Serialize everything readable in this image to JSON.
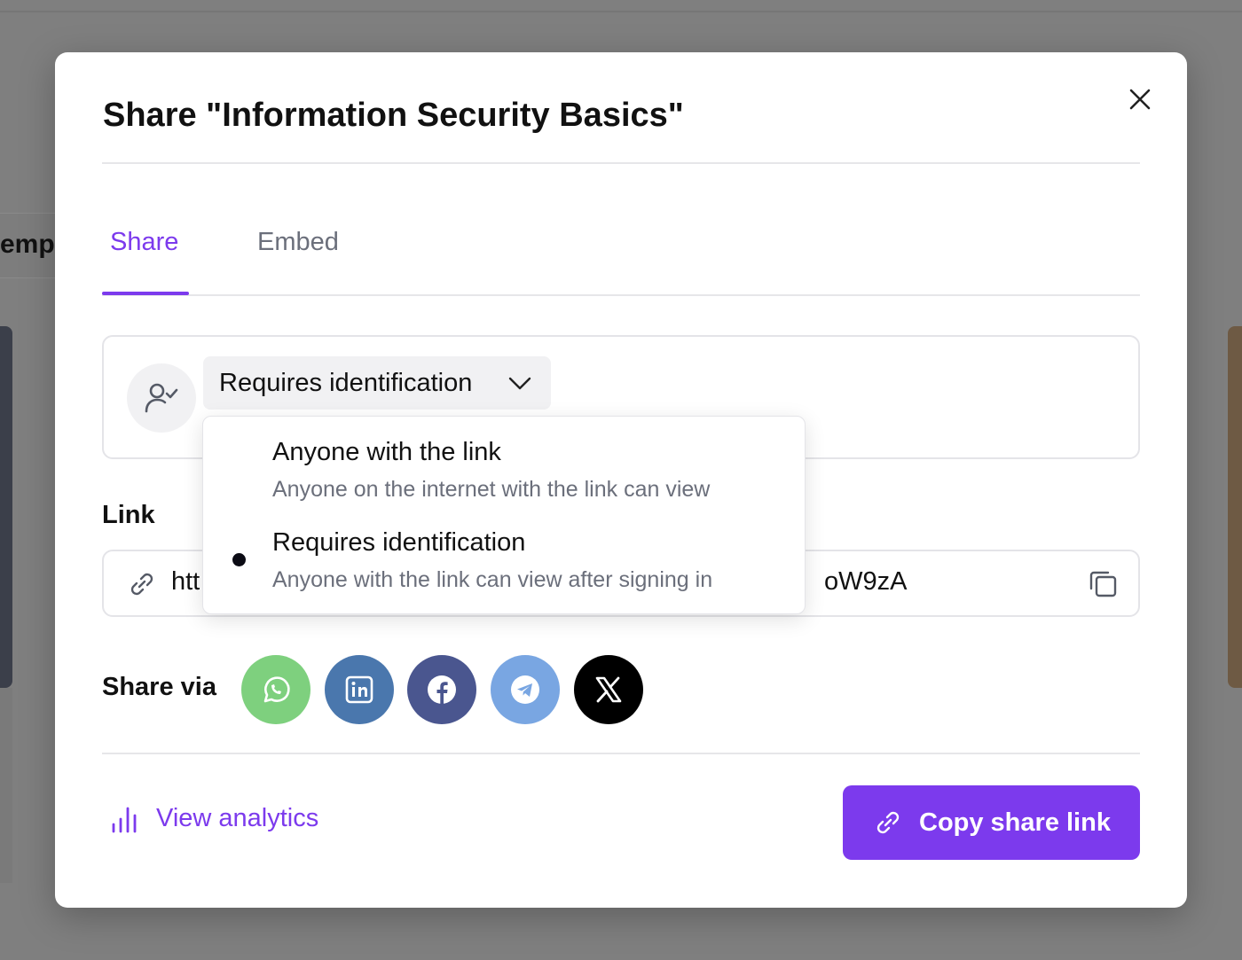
{
  "background": {
    "tab_fragment": "empt"
  },
  "modal": {
    "title": "Share \"Information Security Basics\"",
    "tabs": [
      {
        "label": "Share",
        "active": true
      },
      {
        "label": "Embed",
        "active": false
      }
    ],
    "access": {
      "selected_label": "Requires identification",
      "options": [
        {
          "label": "Anyone with the link",
          "description": "Anyone on the internet with the link can view",
          "selected": false
        },
        {
          "label": "Requires identification",
          "description": "Anyone with the link can view after signing in",
          "selected": true
        }
      ]
    },
    "link": {
      "label": "Link",
      "visible_start": "htt",
      "visible_end": "oW9zA"
    },
    "share_via": {
      "label": "Share via",
      "services": [
        {
          "name": "whatsapp",
          "icon": "whatsapp-icon",
          "color": "#7ed07e"
        },
        {
          "name": "linkedin",
          "icon": "linkedin-icon",
          "color": "#4a77ad"
        },
        {
          "name": "facebook",
          "icon": "facebook-icon",
          "color": "#4a568f"
        },
        {
          "name": "telegram",
          "icon": "telegram-icon",
          "color": "#79a6e2"
        },
        {
          "name": "x",
          "icon": "x-icon",
          "color": "#000000"
        }
      ]
    },
    "footer": {
      "analytics_label": "View analytics",
      "copy_button_label": "Copy share link"
    }
  },
  "colors": {
    "accent": "#7c3aed",
    "overlay": "#7f7f7f"
  }
}
